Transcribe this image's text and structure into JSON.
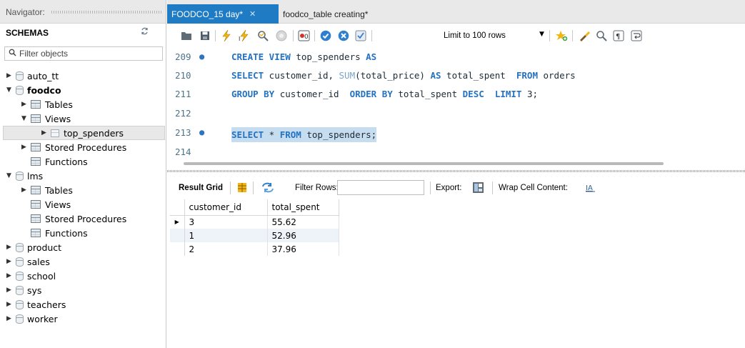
{
  "navigator": {
    "title": "Navigator:",
    "schemas_title": "SCHEMAS",
    "filter_placeholder": "Filter objects",
    "tree": [
      {
        "label": "auto_tt",
        "expanded": false
      },
      {
        "label": "foodco",
        "expanded": true
      },
      {
        "label": "Tables"
      },
      {
        "label": "Views"
      },
      {
        "label": "top_spenders"
      },
      {
        "label": "Stored Procedures"
      },
      {
        "label": "Functions"
      },
      {
        "label": "lms",
        "expanded": true
      },
      {
        "label": "Tables"
      },
      {
        "label": "Views"
      },
      {
        "label": "Stored Procedures"
      },
      {
        "label": "Functions"
      },
      {
        "label": "product"
      },
      {
        "label": "sales"
      },
      {
        "label": "school"
      },
      {
        "label": "sys"
      },
      {
        "label": "teachers"
      },
      {
        "label": "worker"
      }
    ]
  },
  "tabs": [
    {
      "label": "FOODCO_15 day*",
      "active": true
    },
    {
      "label": "foodco_table creating*",
      "active": false
    }
  ],
  "toolbar": {
    "limit_label": "Limit to 100 rows"
  },
  "editor": {
    "lines": [
      {
        "number": "209",
        "marker": true
      },
      {
        "number": "210",
        "marker": false
      },
      {
        "number": "211",
        "marker": false
      },
      {
        "number": "212",
        "marker": false
      },
      {
        "number": "213",
        "marker": true
      },
      {
        "number": "214",
        "marker": false
      }
    ],
    "code": {
      "l209_kw1": "CREATE VIEW",
      "l209_mid": " top_spenders ",
      "l209_kw2": "AS",
      "l210_kw1": "SELECT",
      "l210_mid": " customer_id, ",
      "l210_fn": "SUM",
      "l210_mid2": "(total_price) ",
      "l210_kw2": "AS",
      "l210_mid3": " total_spent  ",
      "l210_kw3": "FROM",
      "l210_end": " orders",
      "l211_kw1": "GROUP BY",
      "l211_mid": " customer_id  ",
      "l211_kw2": "ORDER BY",
      "l211_mid2": " total_spent ",
      "l211_kw3": "DESC",
      "l211_mid3": "  ",
      "l211_kw4": "LIMIT",
      "l211_end": " 3;",
      "l213_kw1": "SELECT",
      "l213_mid": " * ",
      "l213_kw2": "FROM",
      "l213_end": " top_spenders;"
    }
  },
  "results": {
    "result_grid_label": "Result Grid",
    "filter_rows_label": "Filter Rows:",
    "export_label": "Export:",
    "wrap_label": "Wrap Cell Content:",
    "columns": [
      "customer_id",
      "total_spent"
    ],
    "rows": [
      [
        "3",
        "55.62"
      ],
      [
        "1",
        "52.96"
      ],
      [
        "2",
        "37.96"
      ]
    ]
  }
}
